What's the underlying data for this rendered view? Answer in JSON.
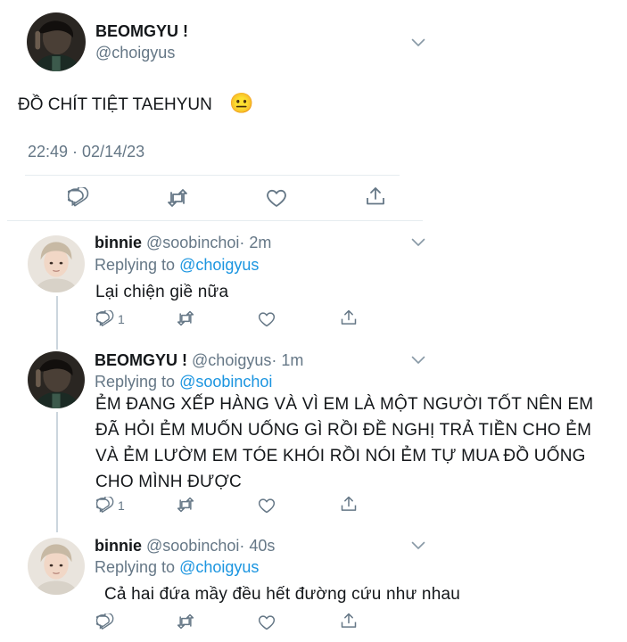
{
  "main_tweet": {
    "display_name": "BEOMGYU !",
    "handle": "@choigyus",
    "text": "ĐỒ CHÍT TIỆT TAEHYUN",
    "emoji": "😐",
    "timestamp": "22:49 · 02/14/23"
  },
  "replies": [
    {
      "display_name": "binnie",
      "handle": "@soobinchoi",
      "time": "· 2m",
      "replying_label": "Replying to",
      "replying_to": "@choigyus",
      "text": "Lại chiện giề nữa",
      "reply_count": "1"
    },
    {
      "display_name": "BEOMGYU !",
      "handle": "@choigyus",
      "time": "· 1m",
      "replying_label": "Replying to",
      "replying_to": "@soobinchoi",
      "text_lines": [
        "ẺM ĐANG XẾP HÀNG VÀ VÌ EM LÀ MỘT NGƯỜI TỐT NÊN EM",
        "ĐÃ HỎI ẺM MUỐN UỐNG GÌ RỒI ĐỀ NGHỊ TRẢ TIỀN CHO ẺM",
        "VÀ ẺM LƯỜM EM TÓE KHÓI RỒI NÓI ẺM TỰ MUA ĐỒ UỐNG",
        "CHO MÌNH ĐƯỢC"
      ],
      "reply_count": "1"
    },
    {
      "display_name": "binnie",
      "handle": "@soobinchoi",
      "time": "· 40s",
      "replying_label": "Replying to",
      "replying_to": "@choigyus",
      "text": "Cả hai đứa mầy đều hết đường cứu như nhau",
      "reply_count": ""
    }
  ],
  "colors": {
    "link": "#1b95e0",
    "muted": "#657786",
    "divider": "#e6ecf0",
    "thread_line": "#ccd6dd"
  },
  "icons": [
    "reply-icon",
    "retweet-icon",
    "like-icon",
    "share-icon",
    "chevron-down-icon"
  ]
}
